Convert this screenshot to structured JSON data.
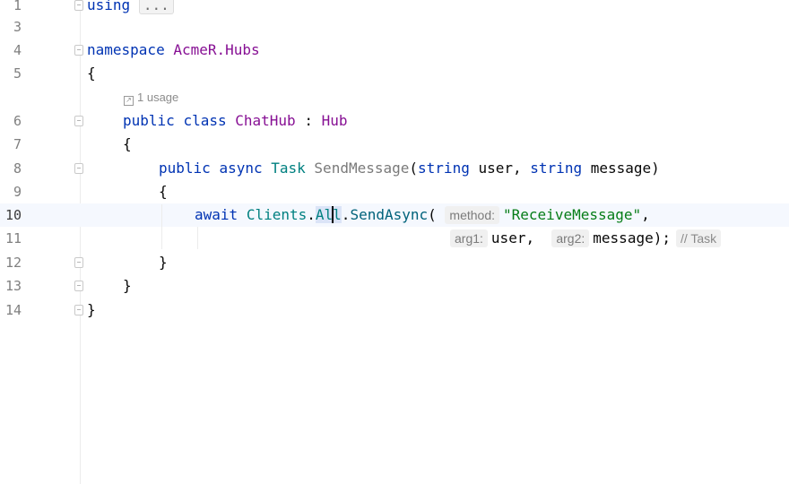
{
  "editor": {
    "lines": [
      {
        "number": "1",
        "using_keyword": "using",
        "folded_placeholder": "..."
      },
      {
        "number": "3"
      },
      {
        "number": "4",
        "kw": "namespace",
        "name": "AcmeR.Hubs"
      },
      {
        "number": "5",
        "brace": "{"
      },
      {
        "number": "6",
        "kw1": "public",
        "kw2": "class",
        "class_name": "ChatHub",
        "colon": ":",
        "base": "Hub"
      },
      {
        "number": "7",
        "brace": "{"
      },
      {
        "number": "8",
        "kw1": "public",
        "kw2": "async",
        "return_type": "Task",
        "method_name": "SendMessage",
        "params_open": "(",
        "param1_type": "string",
        "param1_name": "user",
        "comma": ",",
        "param2_type": "string",
        "param2_name": "message",
        "params_close": ")"
      },
      {
        "number": "9",
        "brace": "{"
      },
      {
        "number": "10",
        "kw": "await",
        "obj": "Clients",
        "dot1": ".",
        "prop_before_caret": "Al",
        "prop_after_caret": "l",
        "dot2": ".",
        "call": "SendAsync",
        "open": "(",
        "hint_method": "method:",
        "string_value": "\"ReceiveMessage\"",
        "comma": ","
      },
      {
        "number": "11",
        "hint_arg1": "arg1:",
        "arg1": "user,",
        "hint_arg2": "arg2:",
        "arg2": "message);",
        "type_hint": "// Task"
      },
      {
        "number": "12",
        "brace": "}"
      },
      {
        "number": "13",
        "brace": "}"
      },
      {
        "number": "14",
        "brace": "}"
      }
    ],
    "usage_hint": "1 usage"
  }
}
